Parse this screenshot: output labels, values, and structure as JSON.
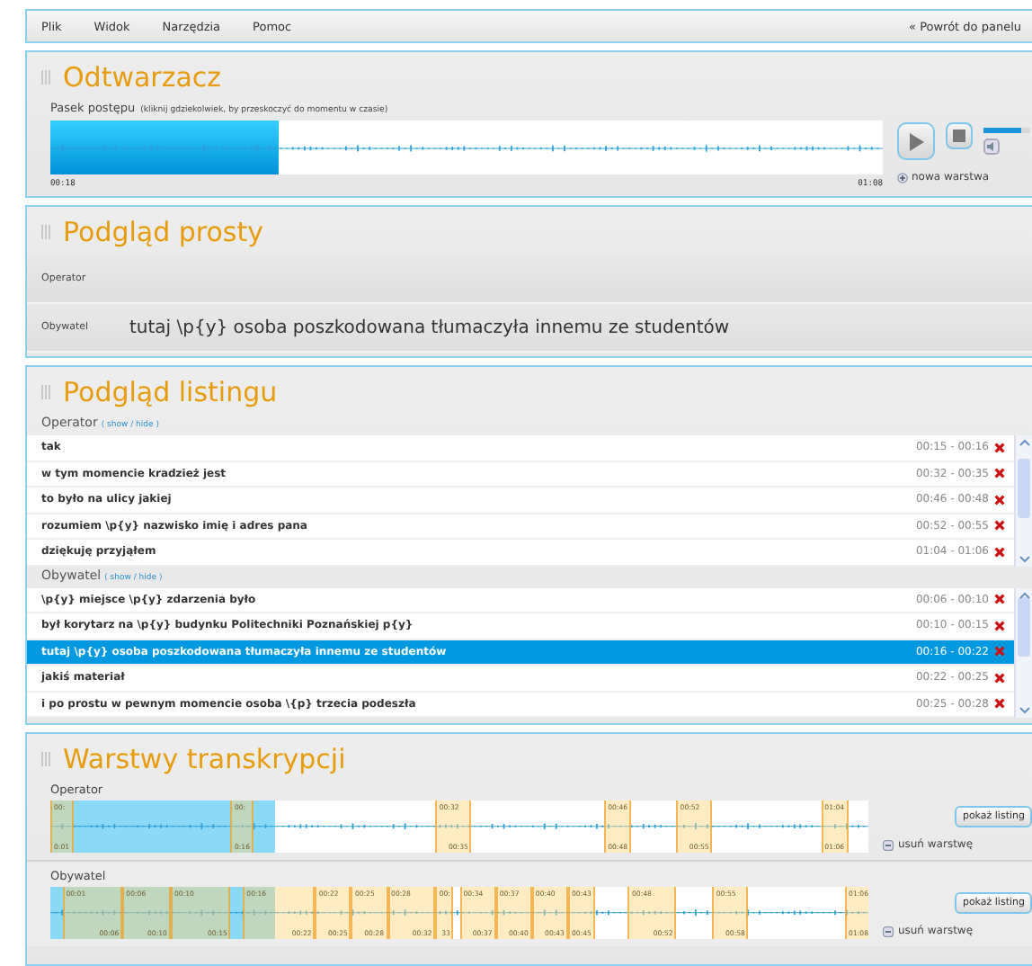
{
  "menu": {
    "items": [
      {
        "label": "Plik"
      },
      {
        "label": "Widok"
      },
      {
        "label": "Narzędzia"
      },
      {
        "label": "Pomoc"
      }
    ],
    "back_link": "« Powrót do panelu"
  },
  "player": {
    "title": "Odtwarzacz",
    "progress_label": "Pasek postępu",
    "progress_hint": "(kliknij gdziekolwiek, by przeskoczyć do momentu w czasie)",
    "progress": {
      "level": 0.275
    },
    "time_start": "00:18",
    "time_end": "01:08",
    "volume": {
      "level": 0.8
    },
    "new_layer": "nowa warstwa"
  },
  "simple_preview": {
    "title": "Podgląd prosty",
    "rows": [
      {
        "speaker": "Operator"
      },
      {
        "speaker": "Obywatel",
        "text": "tutaj \\p{y} osoba poszkodowana tłumaczyła innemu ze studentów"
      }
    ]
  },
  "listing": {
    "title": "Podgląd listingu",
    "groups": [
      {
        "speaker": "Operator",
        "toggle": "( show / hide )",
        "rows": [
          {
            "text": "tak",
            "time": "00:15 - 00:16",
            "selected": false
          },
          {
            "text": "w tym momencie kradzież jest",
            "time": "00:32 - 00:35",
            "selected": false
          },
          {
            "text": "to było na ulicy jakiej",
            "time": "00:46 - 00:48",
            "selected": false
          },
          {
            "text": "rozumiem \\p{y} nazwisko imię i adres pana",
            "time": "00:52 - 00:55",
            "selected": false
          },
          {
            "text": "dziękuję przyjąłem",
            "time": "01:04 - 01:06",
            "selected": false
          }
        ]
      },
      {
        "speaker": "Obywatel",
        "toggle": "( show / hide )",
        "rows": [
          {
            "text": "\\p{y} miejsce \\p{y} zdarzenia było",
            "time": "00:06 - 00:10",
            "selected": false
          },
          {
            "text": "był korytarz na \\p{y} budynku Politechniki Poznańskiej p{y}",
            "time": "00:10 - 00:15",
            "selected": false
          },
          {
            "text": "tutaj \\p{y} osoba poszkodowana tłumaczyła innemu ze studentów",
            "time": "00:16 - 00:22",
            "selected": true
          },
          {
            "text": "jakiś materiał",
            "time": "00:22 - 00:25",
            "selected": false
          },
          {
            "text": "i po prostu w pewnym momencie osoba \\{p} trzecia podeszła",
            "time": "00:25 - 00:28",
            "selected": false
          }
        ]
      }
    ]
  },
  "layers": {
    "title": "Warstwy transkrypcji",
    "items": [
      {
        "name": "Operator",
        "button": "pokaż listing",
        "remove": "usuń warstwę",
        "segments": [
          {
            "start": "00:",
            "end": "0:01"
          },
          {
            "start": "00:",
            "end": "0:16"
          },
          {
            "start": "00:32",
            "end": "00:35"
          },
          {
            "start": "00:46",
            "end": "00:48"
          },
          {
            "start": "00:52",
            "end": "00:55"
          },
          {
            "start": "01:04",
            "end": "01:06"
          }
        ]
      },
      {
        "name": "Obywatel",
        "button": "pokaż listing",
        "remove": "usuń warstwę",
        "segments": [
          {
            "start": "00:01",
            "end": "00:06"
          },
          {
            "start": "00:06",
            "end": "00:10"
          },
          {
            "start": "00:10",
            "end": "00:15"
          },
          {
            "start": "00:16",
            "end": "00:22"
          },
          {
            "start": "00:22",
            "end": "00:25"
          },
          {
            "start": "00:25",
            "end": "00:28"
          },
          {
            "start": "00:28",
            "end": "00:32"
          },
          {
            "start": "00:",
            "end": "33"
          },
          {
            "start": "00:34",
            "end": "00:37"
          },
          {
            "start": "00:37",
            "end": "00:40"
          },
          {
            "start": "00:40",
            "end": "00:43"
          },
          {
            "start": "00:43",
            "end": "00:45"
          },
          {
            "start": "00:48",
            "end": "00:52"
          },
          {
            "start": "00:55",
            "end": "00:58"
          },
          {
            "start": "01:06",
            "end": "01:08"
          }
        ]
      }
    ]
  }
}
